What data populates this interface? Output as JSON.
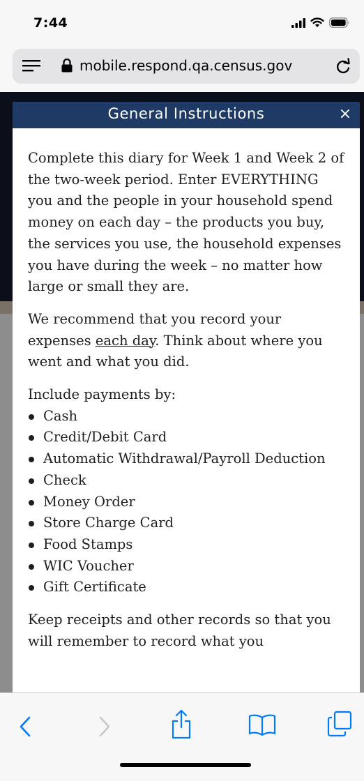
{
  "status_bar": {
    "time": "7:44",
    "icons": [
      "signal-icon",
      "wifi-icon",
      "battery-icon"
    ]
  },
  "browser": {
    "url": "mobile.respond.qa.census.gov",
    "icons": [
      "menu-icon",
      "lock-icon",
      "reload-icon"
    ]
  },
  "modal": {
    "title": "General Instructions",
    "close_label": "×",
    "paragraph1": "Complete this diary for Week 1 and Week 2 of the two-week period. Enter EVERYTHING you and the people in your household spend money on each day – the products you buy, the services you use, the household expenses you have during the week – no matter how large or small they are.",
    "paragraph2_before": "We recommend that you record your expenses ",
    "paragraph2_underlined": "each day",
    "paragraph2_after": ". Think about where you went and what you did.",
    "payments_intro": "Include payments by:",
    "payment_methods": [
      "Cash",
      "Credit/Debit Card",
      "Automatic Withdrawal/Payroll Deduction",
      "Check",
      "Money Order",
      "Store Charge Card",
      "Food Stamps",
      "WIC Voucher",
      "Gift Certificate"
    ],
    "paragraph3": "Keep receipts and other records so that you will remember to record what you"
  },
  "toolbar": {
    "icons": [
      "back-icon",
      "forward-icon",
      "share-icon",
      "bookmarks-icon",
      "tabs-icon"
    ]
  },
  "colors": {
    "modal_header": "#1f3a65",
    "toolbar_active": "#007aff",
    "toolbar_disabled": "#c7c7cc"
  }
}
